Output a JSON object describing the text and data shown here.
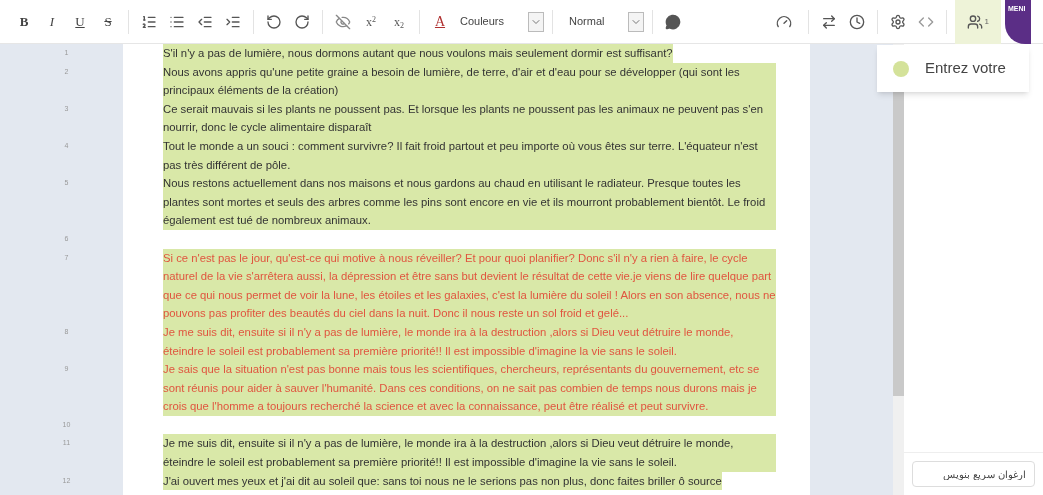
{
  "toolbar": {
    "format_buttons": [
      {
        "label": "B",
        "kind": "bold"
      },
      {
        "label": "I",
        "kind": "italic"
      },
      {
        "label": "U",
        "kind": "underline"
      },
      {
        "label": "S",
        "kind": "strike"
      }
    ],
    "script_buttons": [
      {
        "label": "x",
        "mark": "2",
        "kind": "sup"
      },
      {
        "label": "x",
        "mark": "2",
        "kind": "sub"
      }
    ],
    "text_color_button": "A",
    "color_select": "Couleurs",
    "style_select": "Normal",
    "users_count": "1",
    "logo_text": "MENI"
  },
  "lines": [
    {
      "number": "1",
      "text": "S'il n'y a pas de lumière, nous dormons autant que nous voulons mais seulement dormir est suffisant?",
      "kind": "normal"
    },
    {
      "number": "2",
      "text": "Nous avons appris qu'une petite graine a besoin de lumière, de terre, d'air et d'eau pour se développer (qui sont les principaux éléments de la création)",
      "kind": "normal"
    },
    {
      "number": "3",
      "text": "Ce serait mauvais si les plants ne poussent pas. Et lorsque les plants ne poussent pas les animaux ne peuvent pas s'en nourrir, donc le cycle alimentaire disparaît",
      "kind": "normal"
    },
    {
      "number": "4",
      "text": "Tout le monde a un souci : comment survivre? Il fait froid partout et peu importe où vous êtes sur terre. L'équateur n'est pas très différent de pôle.",
      "kind": "normal"
    },
    {
      "number": "5",
      "text": "Nous restons actuellement dans nos maisons et nous gardons au chaud en utilisant le radiateur. Presque toutes les plantes sont mortes et seuls des arbres comme les pins sont encore en vie et ils mourront probablement bientôt. Le froid également est tué de nombreux animaux.",
      "kind": "normal"
    },
    {
      "number": "6"
    },
    {
      "number": "7",
      "text": "Si ce n'est pas le jour, qu'est-ce qui motive à nous réveiller? Et pour quoi planifier? Donc s'il n'y a rien à faire, le cycle naturel de la vie s'arrêtera aussi, la dépression et être sans but devient le résultat de cette vie.je viens de lire quelque part que ce qui nous permet de voir la lune, les étoiles et les galaxies, c'est la lumière du soleil ! Alors en son absence, nous ne pouvons pas profiter des beautés du ciel dans la nuit. Donc il nous reste un sol froid et gelé...",
      "kind": "flagged"
    },
    {
      "number": "8",
      "text": "Je me suis dit, ensuite si il n'y a pas de lumière, le monde ira à la destruction ,alors si Dieu veut détruire le monde, éteindre le soleil est probablement sa première priorité!! Il est impossible d'imagine la vie sans le soleil.",
      "kind": "flagged"
    },
    {
      "number": "9",
      "text": "Je sais que la situation n'est pas bonne mais tous les scientifiques, chercheurs, représentants du gouvernement, etc se sont réunis pour aider à sauver l'humanité. Dans ces conditions, on ne sait pas combien de temps nous durons mais je crois que l'homme a toujours recherché la science et avec la connaissance, peut être réalisé et peut survivre.",
      "kind": "flagged"
    },
    {
      "number": "10"
    },
    {
      "number": "11",
      "text": "Je me suis dit, ensuite si il n'y a pas de lumière, le monde ira à la destruction ,alors si Dieu veut détruire le monde, éteindre le soleil est probablement sa première priorité!! Il est impossible d'imagine la vie sans le soleil.",
      "kind": "normal"
    },
    {
      "number": "12",
      "text": "J'ai ouvert mes yeux et j'ai dit au soleil que: sans toi nous ne le serions pas non plus, donc faites briller ô source",
      "kind": "normal"
    }
  ],
  "popup": {
    "text": "Entrez votre",
    "color": "#d4e29a"
  },
  "chat": {
    "placeholder": "ارغوان سریع بنویس"
  }
}
